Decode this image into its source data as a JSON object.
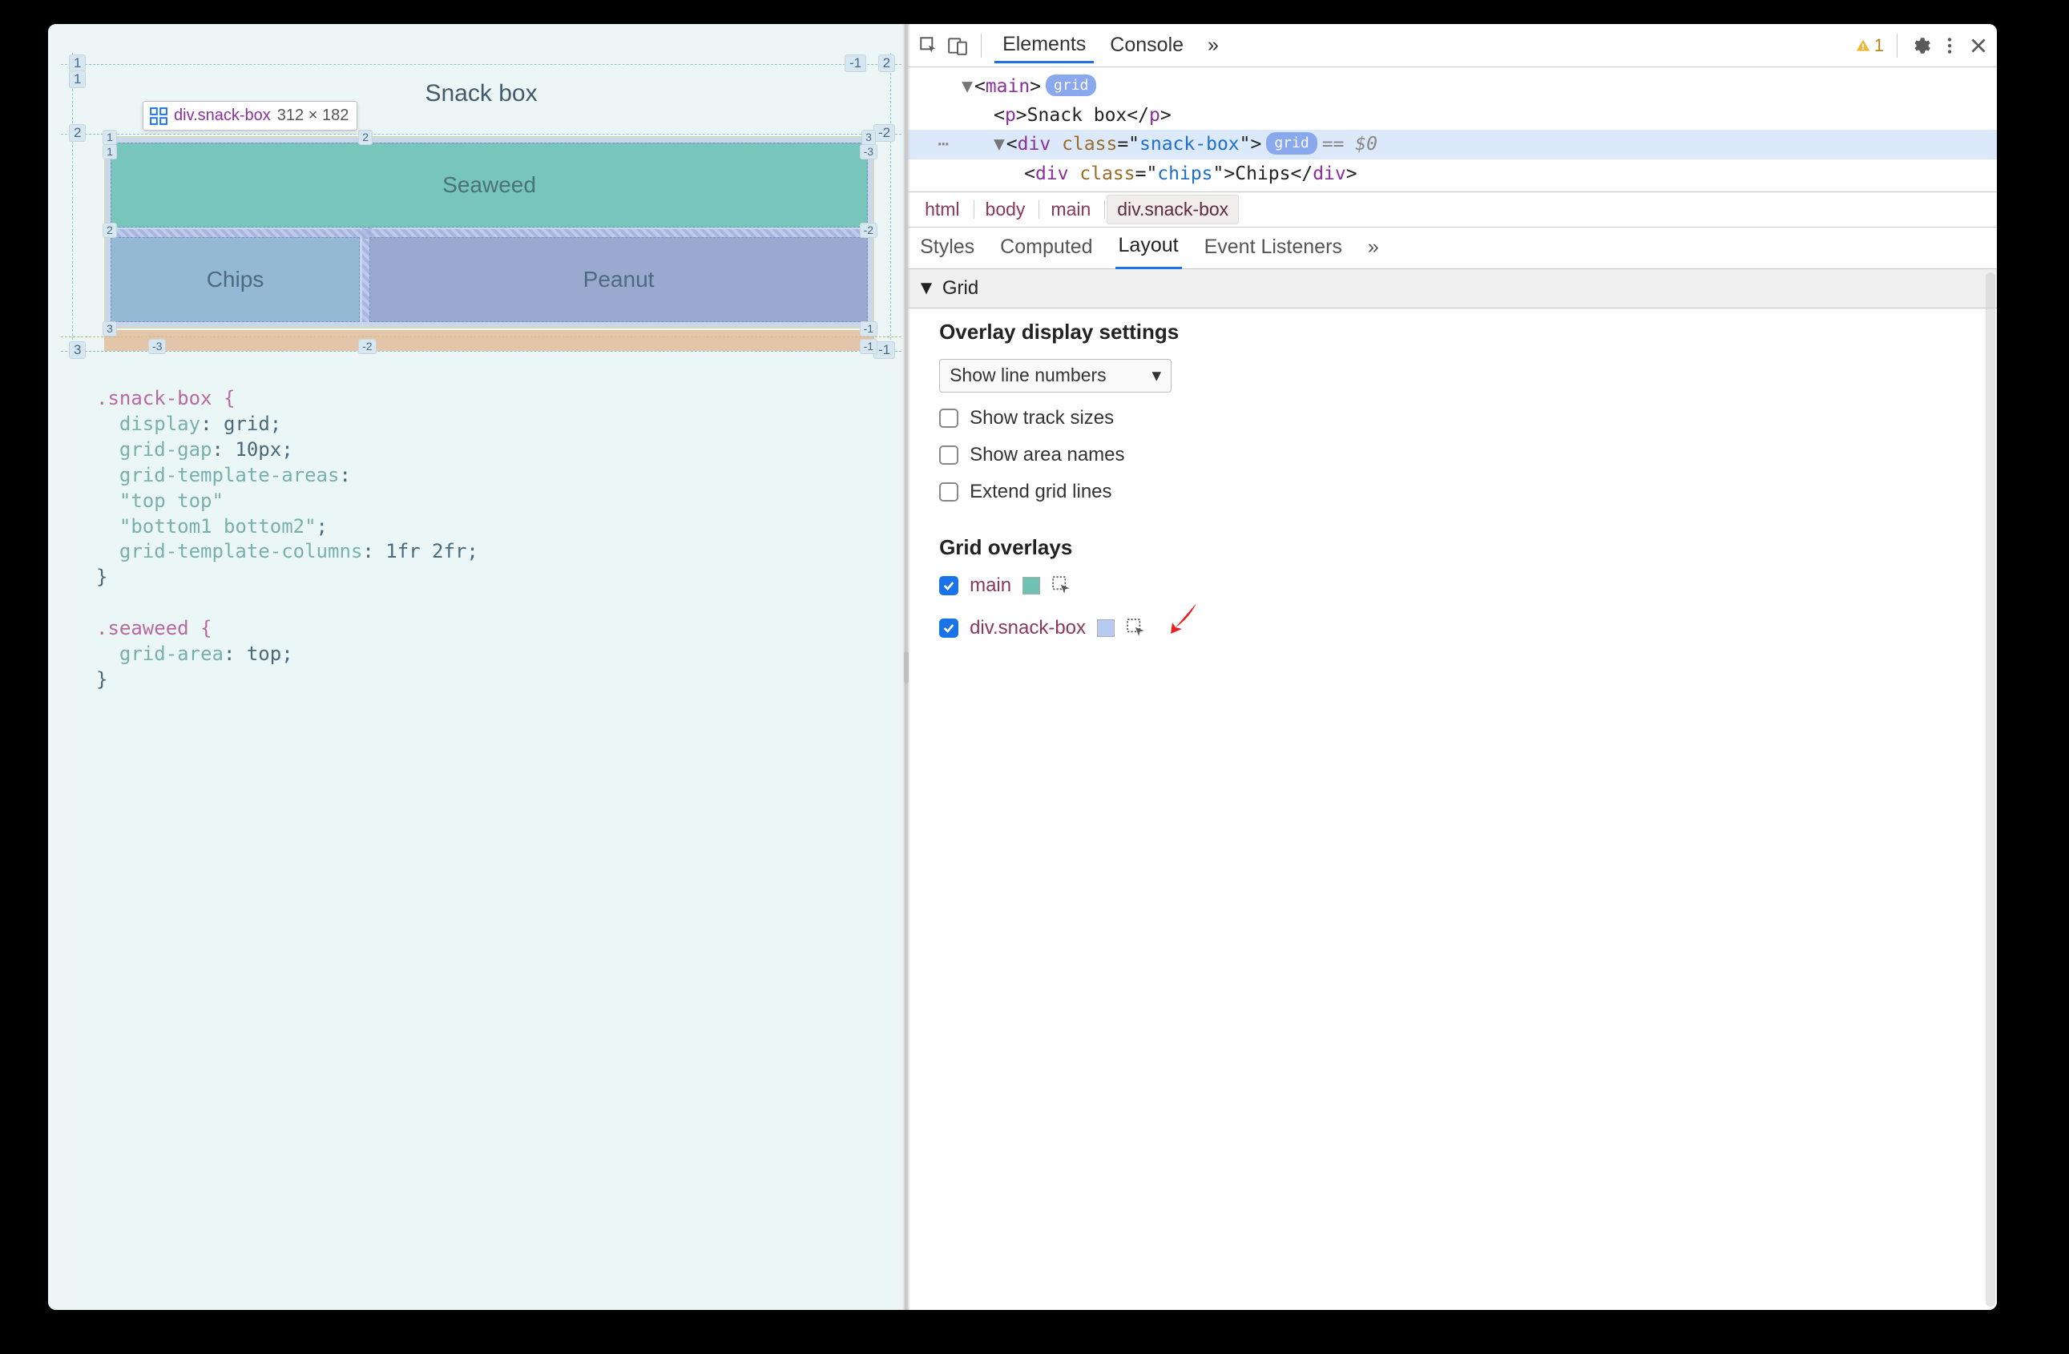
{
  "left": {
    "title": "Snack box",
    "tooltip_elem": "div.snack-box",
    "tooltip_dim": "312 × 182",
    "cells": {
      "seaweed": "Seaweed",
      "chips": "Chips",
      "peanut": "Peanut"
    },
    "outer_lines": {
      "top": "1",
      "r2": "2",
      "r3": "3",
      "neg1": "-1",
      "neg2": "-2"
    },
    "inner_lines": {
      "c1": "1",
      "c2": "2",
      "c3": "3",
      "cneg1": "-1",
      "cneg2": "-2",
      "cneg3": "-3",
      "r1": "1",
      "r2": "2",
      "r3": "3",
      "rneg1": "-1",
      "rneg2": "-2",
      "rneg3": "-3"
    },
    "code": {
      "l1": ".snack-box {",
      "l2a": "display",
      "l2b": "grid",
      "l3a": "grid-gap",
      "l3b": "10px",
      "l4a": "grid-template-areas",
      "l5": "\"top top\"",
      "l6": "\"bottom1 bottom2\"",
      "l7a": "grid-template-columns",
      "l7b": "1fr 2fr",
      "l8": "}",
      "l9": ".seaweed {",
      "l10a": "grid-area",
      "l10b": "top",
      "l11": "}"
    }
  },
  "toolbar": {
    "tabs": [
      "Elements",
      "Console"
    ],
    "more": "»",
    "warnings": "1"
  },
  "dom": {
    "line1_tag": "main",
    "line1_badge": "grid",
    "line2_tag": "p",
    "line2_text": "Snack box",
    "line3_tag": "div",
    "line3_attr": "class",
    "line3_val": "snack-box",
    "line3_badge": "grid",
    "line3_eq": "== $0",
    "line4_tag": "div",
    "line4_attr": "class",
    "line4_val": "chips",
    "line4_text": "Chips",
    "ellipsis": "⋯"
  },
  "breadcrumbs": [
    "html",
    "body",
    "main",
    "div.snack-box"
  ],
  "subtabs": [
    "Styles",
    "Computed",
    "Layout",
    "Event Listeners"
  ],
  "subtabs_more": "»",
  "layout": {
    "disclosure": "Grid",
    "overlay_settings": "Overlay display settings",
    "select_value": "Show line numbers",
    "options": [
      "Show track sizes",
      "Show area names",
      "Extend grid lines"
    ],
    "overlays_heading": "Grid overlays",
    "overlays": [
      {
        "name": "main",
        "color": "#6ec2b3",
        "checked": true
      },
      {
        "name": "div.snack-box",
        "color": "#b9caf0",
        "checked": true
      }
    ]
  }
}
